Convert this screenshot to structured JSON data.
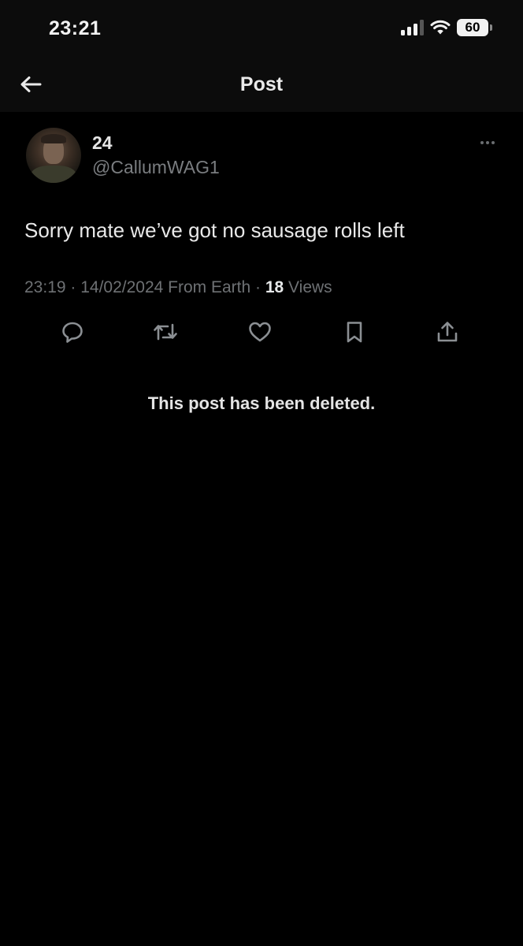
{
  "status_bar": {
    "time": "23:21",
    "battery": "60",
    "icons": [
      "signal-icon",
      "wifi-icon",
      "battery-icon"
    ]
  },
  "nav": {
    "title": "Post",
    "back_icon": "arrow-left-icon"
  },
  "post": {
    "display_name": "24",
    "handle": "@CallumWAG1",
    "text": "Sorry mate we’ve got no sausage rolls left",
    "meta_prefix": "23:19 · 14/02/2024 From Earth · ",
    "views_count": "18",
    "views_label": " Views",
    "more_icon": "more-dots-icon",
    "actions": [
      "reply-icon",
      "repost-icon",
      "like-icon",
      "bookmark-icon",
      "share-icon"
    ]
  },
  "deleted_notice": "This post has been deleted.",
  "colors": {
    "background": "#000000",
    "header_background": "#0c0c0c",
    "text_primary": "#e7e9ea",
    "text_secondary": "#6e7174"
  }
}
